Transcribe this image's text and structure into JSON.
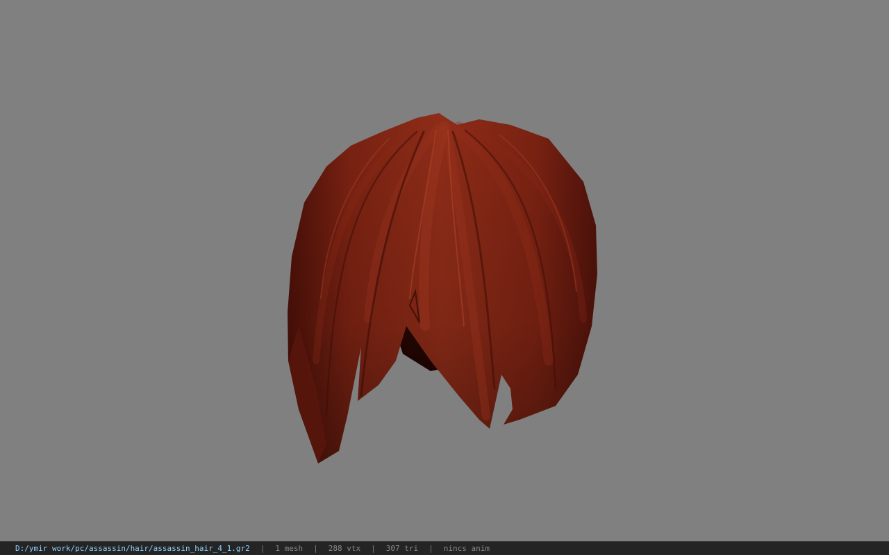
{
  "viewer": {
    "background_color": "#808080",
    "model_name": "assassin_hair_4_1",
    "model_color": "#7a2010"
  },
  "status_bar": {
    "file_path": "D:/ymir work/pc/assassin/hair/assassin_hair_4_1.gr2",
    "separator": "|",
    "mesh_count": "1 mesh",
    "vertex_count": "288 vtx",
    "triangle_count": "307 tri",
    "anim_status": "nincs anim",
    "path_color": "#8fd3ff",
    "text_color": "#8a8a8a"
  }
}
